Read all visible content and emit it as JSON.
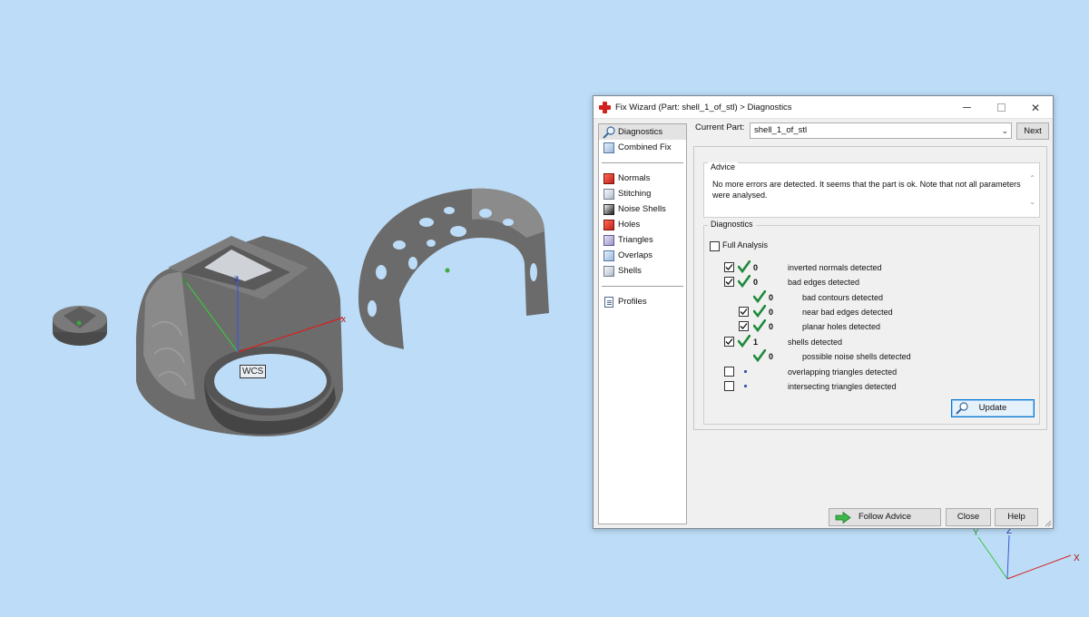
{
  "viewport": {
    "wcs_label": "WCS",
    "model_axes": {
      "x": "x",
      "y": "y",
      "z": "z"
    },
    "corner_axes": {
      "x": "X",
      "y": "Y",
      "z": "Z"
    }
  },
  "dialog": {
    "title": "Fix Wizard (Part: shell_1_of_stl) > Diagnostics",
    "window_buttons": {
      "close": "✕"
    },
    "nav": {
      "top_items": [
        {
          "label": "Diagnostics",
          "icon": "magnifier-icon",
          "selected": true
        },
        {
          "label": "Combined Fix",
          "icon": "cube-icon"
        }
      ],
      "fix_items": [
        {
          "label": "Normals",
          "icon": "normals-cube-icon"
        },
        {
          "label": "Stitching",
          "icon": "stitching-cube-icon"
        },
        {
          "label": "Noise Shells",
          "icon": "noise-shells-icon"
        },
        {
          "label": "Holes",
          "icon": "holes-cube-icon"
        },
        {
          "label": "Triangles",
          "icon": "triangles-cube-icon"
        },
        {
          "label": "Overlaps",
          "icon": "overlaps-cube-icon"
        },
        {
          "label": "Shells",
          "icon": "shells-cube-icon"
        }
      ],
      "bottom_items": [
        {
          "label": "Profiles",
          "icon": "document-icon"
        }
      ]
    },
    "current_part": {
      "label": "Current Part:",
      "value": "shell_1_of_stl",
      "next_label": "Next"
    },
    "advice": {
      "title": "Advice",
      "text": "No more errors are detected. It seems that the part is ok. Note that not all parameters were analysed."
    },
    "diagnostics": {
      "title": "Diagnostics",
      "full_analysis_label": "Full Analysis",
      "full_analysis_checked": false,
      "rows": [
        {
          "checked": true,
          "status": "ok",
          "count": "0",
          "label": "inverted normals detected"
        },
        {
          "checked": true,
          "status": "ok",
          "count": "0",
          "label": "bad edges detected"
        },
        {
          "checked": null,
          "status": "ok",
          "count": "0",
          "label": "bad contours detected"
        },
        {
          "checked": true,
          "status": "ok",
          "count": "0",
          "label": "near bad edges detected"
        },
        {
          "checked": true,
          "status": "ok",
          "count": "0",
          "label": "planar holes detected"
        },
        {
          "checked": true,
          "status": "ok",
          "count": "1",
          "label": "shells detected"
        },
        {
          "checked": null,
          "status": "ok",
          "count": "0",
          "label": "possible noise shells detected"
        },
        {
          "checked": false,
          "status": "pending",
          "count": "",
          "label": "overlapping triangles detected"
        },
        {
          "checked": false,
          "status": "pending",
          "count": "",
          "label": "intersecting triangles detected"
        }
      ],
      "update_label": "Update"
    },
    "footer": {
      "follow_advice_label": "Follow Advice",
      "close_label": "Close",
      "help_label": "Help"
    },
    "colors": {
      "ok_tick": "#1f8a3b",
      "accent": "#0078d7",
      "close_icon_red": "#d2221c"
    }
  }
}
